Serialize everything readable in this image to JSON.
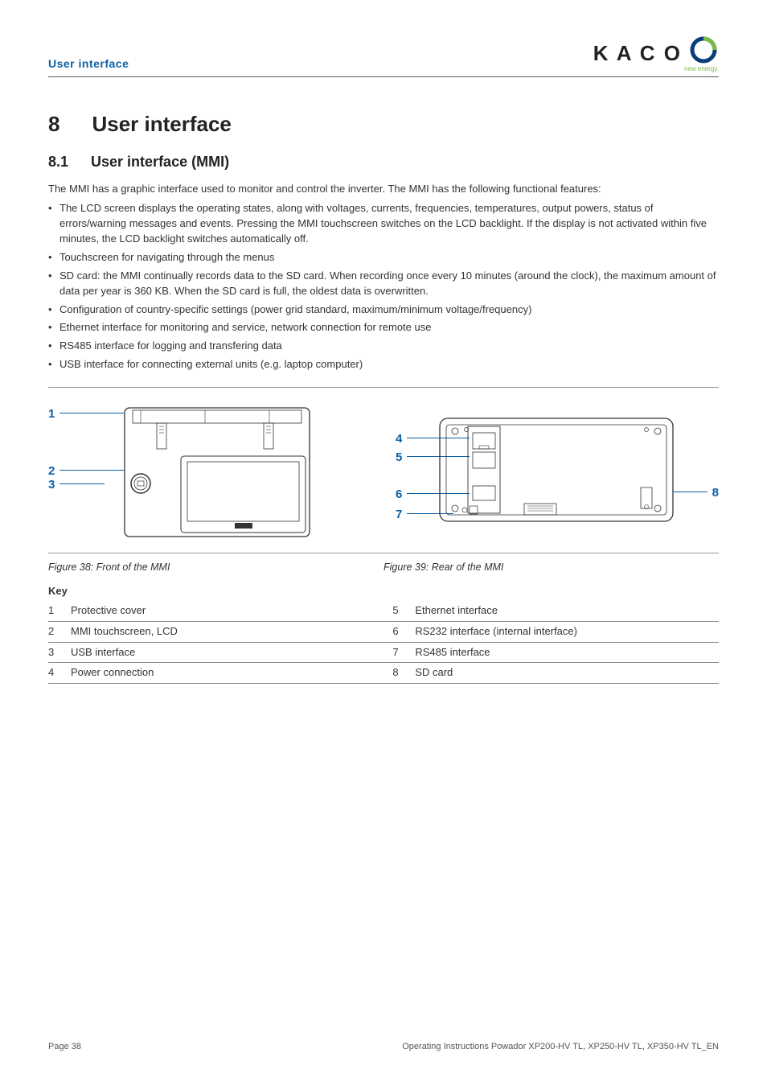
{
  "header": {
    "section": "User interface"
  },
  "logo": {
    "text": "K A C O",
    "tagline": "new energy."
  },
  "h1": {
    "num": "8",
    "text": "User interface"
  },
  "h2": {
    "num": "8.1",
    "text": "User interface (MMI)"
  },
  "intro": "The MMI has a graphic interface used to monitor and control the inverter. The MMI has the following functional features:",
  "bullets": [
    "The LCD screen displays the operating states, along with voltages, currents, frequencies, temperatures, output powers, status of errors/warning messages and events. Pressing the MMI touchscreen switches on the LCD backlight. If the display is not activated within five minutes, the LCD backlight switches automatically off.",
    "Touchscreen for navigating through the menus",
    "SD card: the MMI continually records data to the SD card. When recording once every 10 minutes (around the clock), the maximum amount of data per year is 360 KB. When the SD card is full, the oldest data is overwritten.",
    "Configuration of country-specific settings (power grid standard, maximum/minimum voltage/frequency)",
    "Ethernet interface for monitoring and service, network connection for remote use",
    "RS485 interface for logging and transfering data",
    "USB interface for connecting external units (e.g. laptop computer)"
  ],
  "callouts_front": {
    "1": "1",
    "2": "2",
    "3": "3"
  },
  "callouts_rear": {
    "4": "4",
    "5": "5",
    "6": "6",
    "7": "7",
    "8": "8"
  },
  "captions": {
    "front": "Figure 38: Front of the MMI",
    "rear": "Figure 39: Rear of the MMI"
  },
  "key_title": "Key",
  "key_rows": [
    {
      "l_num": "1",
      "l_text": "Protective cover",
      "r_num": "5",
      "r_text": "Ethernet interface"
    },
    {
      "l_num": "2",
      "l_text": "MMI touchscreen, LCD",
      "r_num": "6",
      "r_text": "RS232 interface (internal interface)"
    },
    {
      "l_num": "3",
      "l_text": "USB interface",
      "r_num": "7",
      "r_text": "RS485 interface"
    },
    {
      "l_num": "4",
      "l_text": "Power connection",
      "r_num": "8",
      "r_text": "SD card"
    }
  ],
  "footer": {
    "page": "Page 38",
    "doc": "Operating Instructions Powador XP200-HV TL, XP250-HV TL, XP350-HV TL_EN"
  }
}
